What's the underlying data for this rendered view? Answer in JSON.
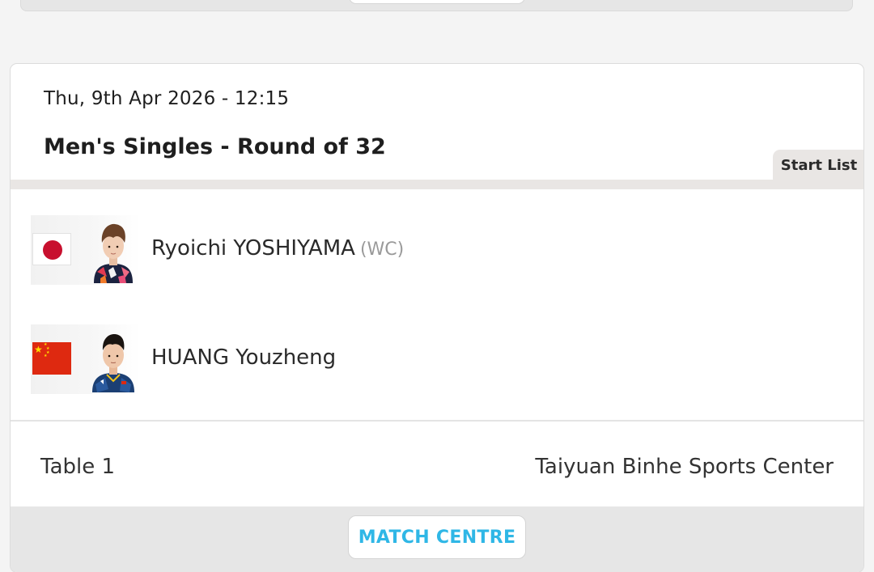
{
  "match": {
    "datetime": "Thu, 9th Apr 2026 - 12:15",
    "event": "Men's Singles - Round of 32",
    "start_list_label": "Start List",
    "players": [
      {
        "name": "Ryoichi YOSHIYAMA",
        "tag": "(WC)",
        "flag_icon": "japan-flag-icon",
        "avatar_icon": "player-photo"
      },
      {
        "name": "HUANG Youzheng",
        "tag": "",
        "flag_icon": "china-flag-icon",
        "avatar_icon": "player-photo"
      }
    ],
    "table": "Table 1",
    "venue": "Taiyuan Binhe Sports Center",
    "match_centre_label": "MATCH CENTRE"
  },
  "colors": {
    "accent": "#2fb7e6",
    "tab_bg": "#e9e6e4",
    "japan_red": "#c8102e",
    "china_red": "#de2910",
    "china_star": "#ffde00"
  }
}
